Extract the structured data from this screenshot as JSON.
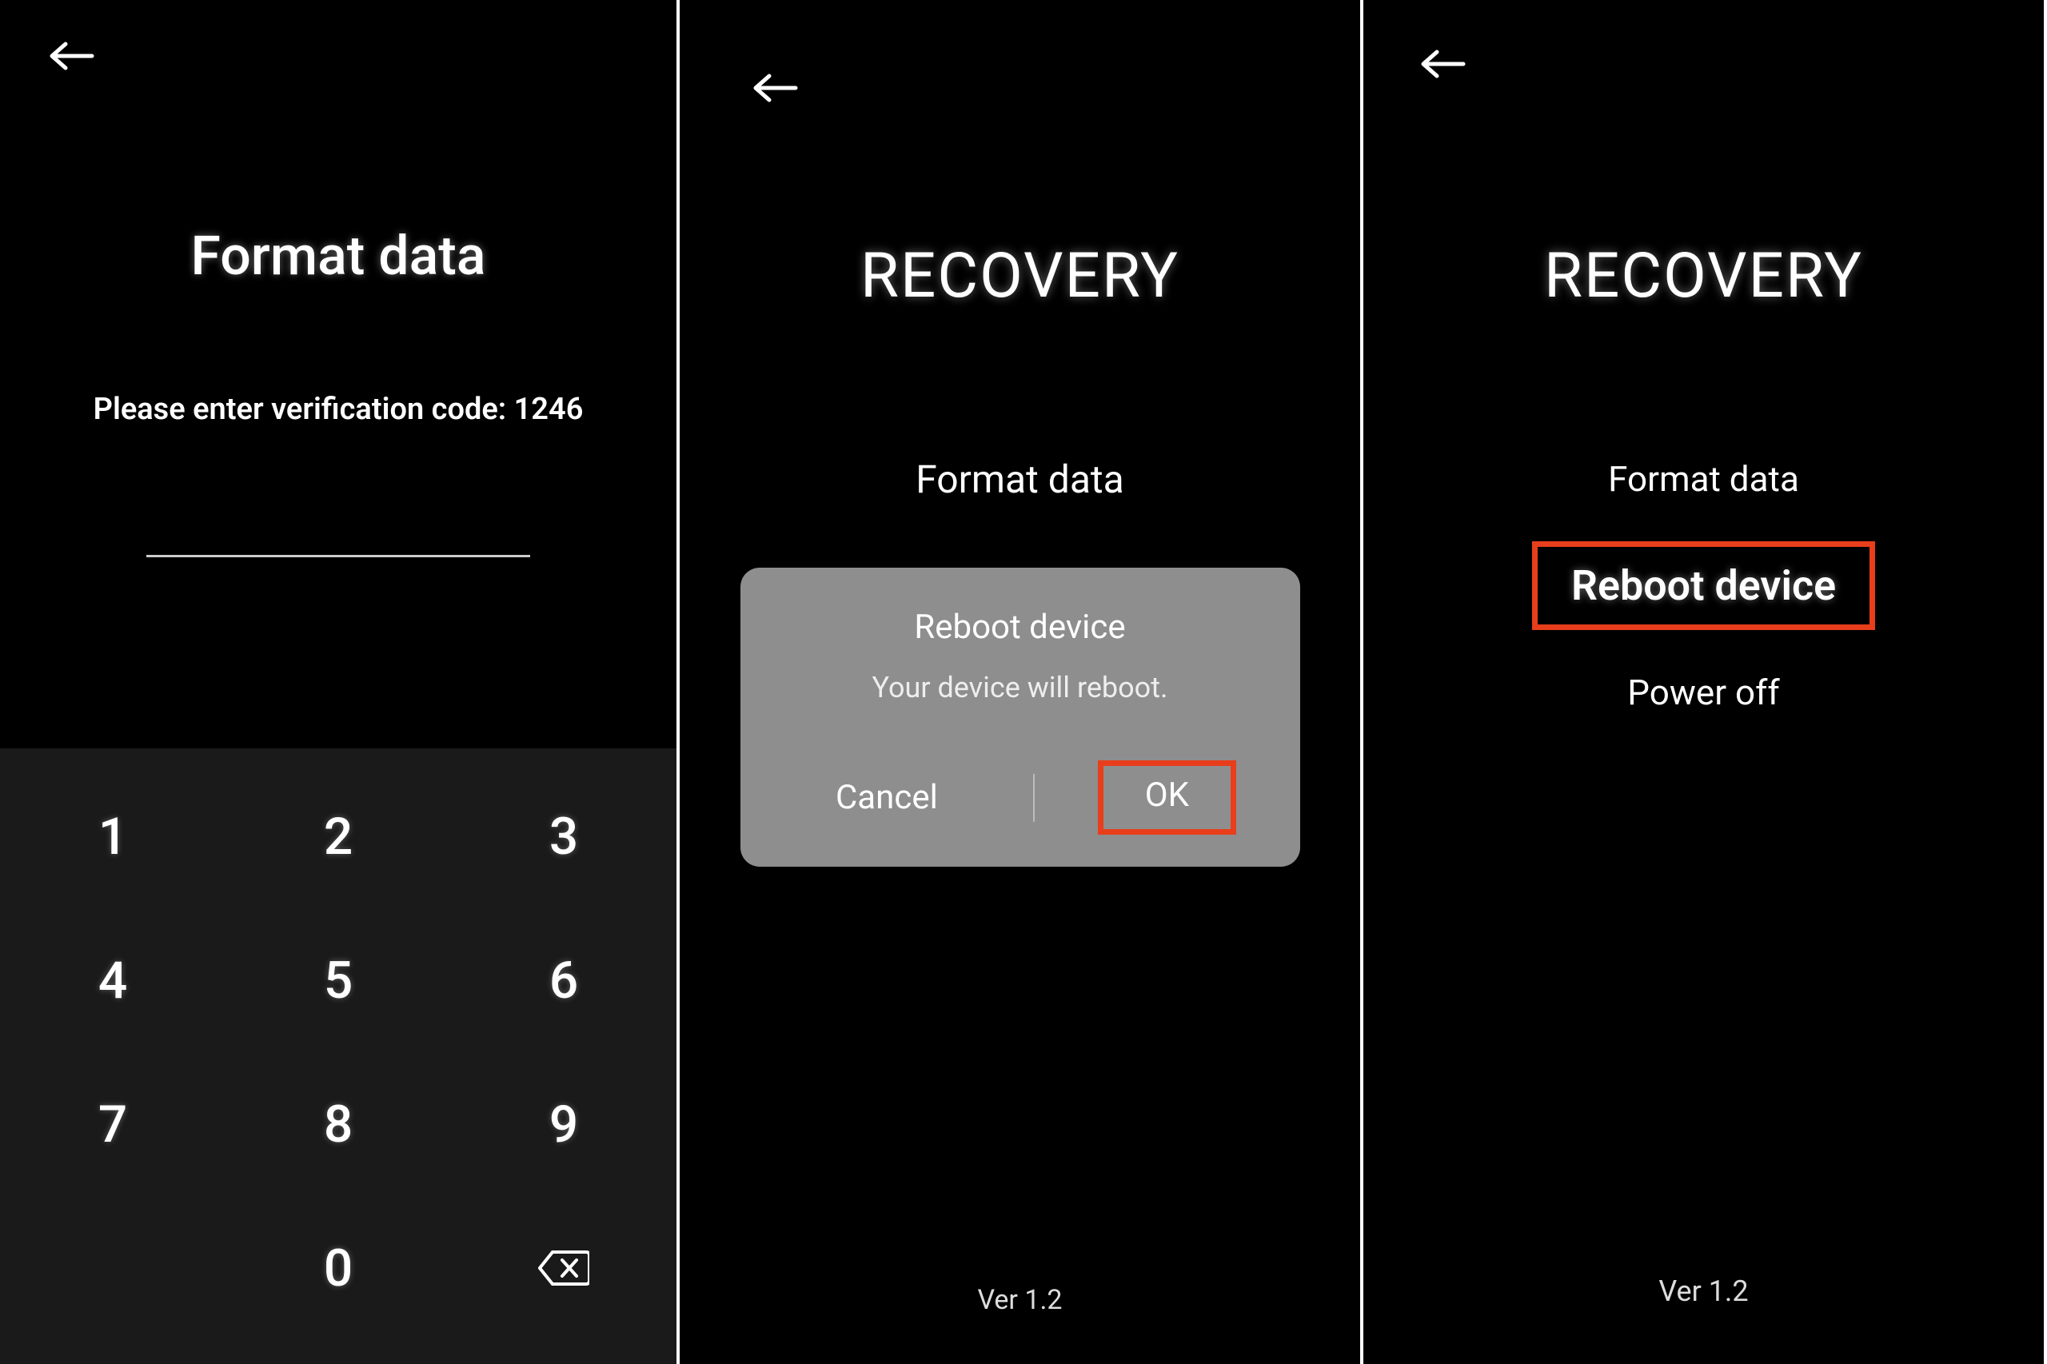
{
  "panel1": {
    "title": "Format data",
    "subtitle": "Please enter verification code: 1246",
    "keypad": {
      "k1": "1",
      "k2": "2",
      "k3": "3",
      "k4": "4",
      "k5": "5",
      "k6": "6",
      "k7": "7",
      "k8": "8",
      "k9": "9",
      "k0": "0"
    }
  },
  "panel2": {
    "title": "RECOVERY",
    "option_format": "Format data",
    "dialog": {
      "title": "Reboot device",
      "message": "Your device will reboot.",
      "cancel": "Cancel",
      "ok": "OK"
    },
    "version": "Ver 1.2"
  },
  "panel3": {
    "title": "RECOVERY",
    "menu": {
      "format": "Format data",
      "reboot": "Reboot device",
      "poweroff": "Power off"
    },
    "version": "Ver 1.2"
  },
  "colors": {
    "highlight": "#e83e1c",
    "dialog_bg": "#8e8e8e"
  }
}
